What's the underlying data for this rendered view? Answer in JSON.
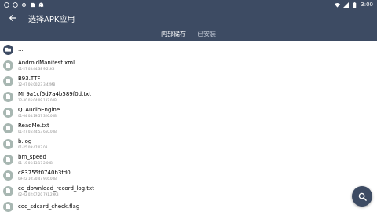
{
  "status_bar": {
    "time": "3:00",
    "left_icons": [
      "notification-icon",
      "notification-icon",
      "settings-icon",
      "sd-card-icon",
      "ghost-icon"
    ],
    "right_icons": [
      "wifi-icon",
      "signal-icon",
      "battery-icon"
    ]
  },
  "app_bar": {
    "title": "选择APK应用",
    "back_icon": "arrow-back-icon"
  },
  "tabs": [
    {
      "label": "内部储存",
      "active": true
    },
    {
      "label": "已安装",
      "active": false
    }
  ],
  "files": [
    {
      "name": "...",
      "meta": "",
      "icon": "folder-icon"
    },
    {
      "name": "AndroidManifest.xml",
      "meta": "01-27 05:44:38  9.21KB",
      "icon": "file-icon"
    },
    {
      "name": "B93.TTF",
      "meta": "12-07 06:00:23  3.42MB",
      "icon": "file-icon"
    },
    {
      "name": "MI 9a1cf5d7a4b589f0d.txt",
      "meta": "12-30 05:04:09  132.00B",
      "icon": "file-icon"
    },
    {
      "name": "QTAudioEngine",
      "meta": "01-04 04:19:57  326.00B",
      "icon": "file-icon"
    },
    {
      "name": "ReadMe.txt",
      "meta": "01-27 05:44:53  650.00B",
      "icon": "file-icon"
    },
    {
      "name": "b.log",
      "meta": "01-25 09:47:03  0B",
      "icon": "file-icon"
    },
    {
      "name": "bm_speed",
      "meta": "01-19 06:13:17  2.00B",
      "icon": "file-icon"
    },
    {
      "name": "c83755f0740b3fd0",
      "meta": "09-22 10:30:47  916.00B",
      "icon": "file-icon"
    },
    {
      "name": "cc_download_record_log.txt",
      "meta": "02-02 02:07:20  791.29KB",
      "icon": "file-icon"
    },
    {
      "name": "coc_sdcard_check.flag",
      "meta": "",
      "icon": "file-icon"
    }
  ],
  "fab": {
    "icon": "search-icon"
  },
  "colors": {
    "primary": "#3d4b63",
    "file_icon_bg": "#a8b7b2",
    "meta_text": "#8e8e8e"
  }
}
